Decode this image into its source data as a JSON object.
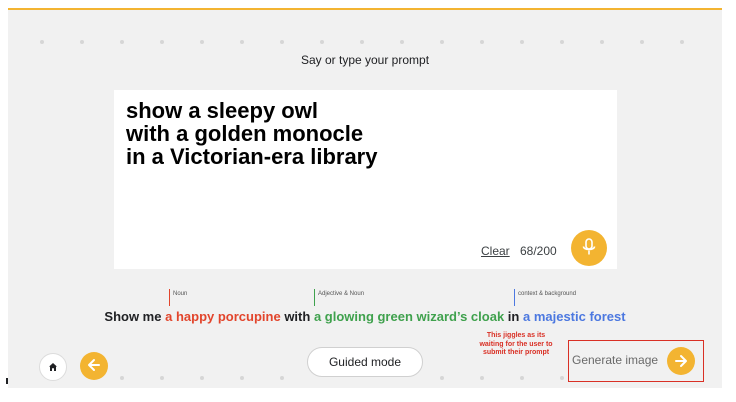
{
  "header": {
    "title": "Say or type your prompt"
  },
  "prompt": {
    "lines": [
      "show a sleepy owl",
      "with a golden monocle",
      "in a Victorian-era library"
    ],
    "clear_label": "Clear",
    "counter": "68/200"
  },
  "mic": {
    "icon": "microphone-icon"
  },
  "guide": {
    "annotations": {
      "noun": "Noun",
      "adjective_noun": "Adjective & Noun",
      "context": "context & background"
    },
    "example": {
      "prefix": "Show me",
      "noun": "a happy porcupine",
      "with": "with",
      "adjective_noun": "a glowing green wizard’s cloak",
      "in": "in",
      "context": "a majestic forest"
    }
  },
  "footer": {
    "home_icon": "home-icon",
    "back_icon": "arrow-left-icon",
    "guided_mode_label": "Guided mode",
    "note": "This jiggles as its waiting for the user to submit their prompt",
    "generate_label": "Generate image",
    "generate_icon": "arrow-right-icon"
  },
  "colors": {
    "accent": "#f3b431",
    "noun": "#e2452c",
    "adjective_noun": "#3fa14d",
    "context": "#4c78e0",
    "annotation_red": "#d93025"
  }
}
